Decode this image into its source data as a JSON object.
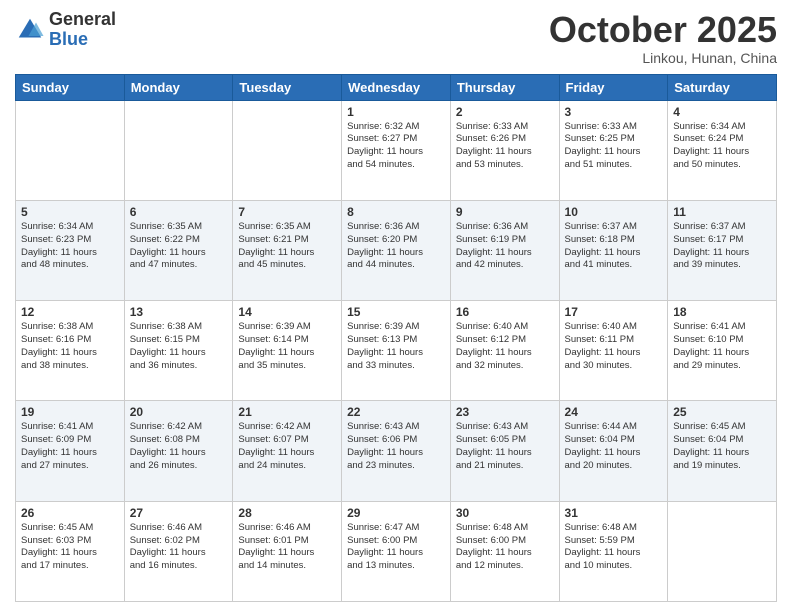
{
  "header": {
    "logo_general": "General",
    "logo_blue": "Blue",
    "month_title": "October 2025",
    "location": "Linkou, Hunan, China"
  },
  "weekdays": [
    "Sunday",
    "Monday",
    "Tuesday",
    "Wednesday",
    "Thursday",
    "Friday",
    "Saturday"
  ],
  "weeks": [
    [
      {
        "day": "",
        "info": ""
      },
      {
        "day": "",
        "info": ""
      },
      {
        "day": "",
        "info": ""
      },
      {
        "day": "1",
        "info": "Sunrise: 6:32 AM\nSunset: 6:27 PM\nDaylight: 11 hours\nand 54 minutes."
      },
      {
        "day": "2",
        "info": "Sunrise: 6:33 AM\nSunset: 6:26 PM\nDaylight: 11 hours\nand 53 minutes."
      },
      {
        "day": "3",
        "info": "Sunrise: 6:33 AM\nSunset: 6:25 PM\nDaylight: 11 hours\nand 51 minutes."
      },
      {
        "day": "4",
        "info": "Sunrise: 6:34 AM\nSunset: 6:24 PM\nDaylight: 11 hours\nand 50 minutes."
      }
    ],
    [
      {
        "day": "5",
        "info": "Sunrise: 6:34 AM\nSunset: 6:23 PM\nDaylight: 11 hours\nand 48 minutes."
      },
      {
        "day": "6",
        "info": "Sunrise: 6:35 AM\nSunset: 6:22 PM\nDaylight: 11 hours\nand 47 minutes."
      },
      {
        "day": "7",
        "info": "Sunrise: 6:35 AM\nSunset: 6:21 PM\nDaylight: 11 hours\nand 45 minutes."
      },
      {
        "day": "8",
        "info": "Sunrise: 6:36 AM\nSunset: 6:20 PM\nDaylight: 11 hours\nand 44 minutes."
      },
      {
        "day": "9",
        "info": "Sunrise: 6:36 AM\nSunset: 6:19 PM\nDaylight: 11 hours\nand 42 minutes."
      },
      {
        "day": "10",
        "info": "Sunrise: 6:37 AM\nSunset: 6:18 PM\nDaylight: 11 hours\nand 41 minutes."
      },
      {
        "day": "11",
        "info": "Sunrise: 6:37 AM\nSunset: 6:17 PM\nDaylight: 11 hours\nand 39 minutes."
      }
    ],
    [
      {
        "day": "12",
        "info": "Sunrise: 6:38 AM\nSunset: 6:16 PM\nDaylight: 11 hours\nand 38 minutes."
      },
      {
        "day": "13",
        "info": "Sunrise: 6:38 AM\nSunset: 6:15 PM\nDaylight: 11 hours\nand 36 minutes."
      },
      {
        "day": "14",
        "info": "Sunrise: 6:39 AM\nSunset: 6:14 PM\nDaylight: 11 hours\nand 35 minutes."
      },
      {
        "day": "15",
        "info": "Sunrise: 6:39 AM\nSunset: 6:13 PM\nDaylight: 11 hours\nand 33 minutes."
      },
      {
        "day": "16",
        "info": "Sunrise: 6:40 AM\nSunset: 6:12 PM\nDaylight: 11 hours\nand 32 minutes."
      },
      {
        "day": "17",
        "info": "Sunrise: 6:40 AM\nSunset: 6:11 PM\nDaylight: 11 hours\nand 30 minutes."
      },
      {
        "day": "18",
        "info": "Sunrise: 6:41 AM\nSunset: 6:10 PM\nDaylight: 11 hours\nand 29 minutes."
      }
    ],
    [
      {
        "day": "19",
        "info": "Sunrise: 6:41 AM\nSunset: 6:09 PM\nDaylight: 11 hours\nand 27 minutes."
      },
      {
        "day": "20",
        "info": "Sunrise: 6:42 AM\nSunset: 6:08 PM\nDaylight: 11 hours\nand 26 minutes."
      },
      {
        "day": "21",
        "info": "Sunrise: 6:42 AM\nSunset: 6:07 PM\nDaylight: 11 hours\nand 24 minutes."
      },
      {
        "day": "22",
        "info": "Sunrise: 6:43 AM\nSunset: 6:06 PM\nDaylight: 11 hours\nand 23 minutes."
      },
      {
        "day": "23",
        "info": "Sunrise: 6:43 AM\nSunset: 6:05 PM\nDaylight: 11 hours\nand 21 minutes."
      },
      {
        "day": "24",
        "info": "Sunrise: 6:44 AM\nSunset: 6:04 PM\nDaylight: 11 hours\nand 20 minutes."
      },
      {
        "day": "25",
        "info": "Sunrise: 6:45 AM\nSunset: 6:04 PM\nDaylight: 11 hours\nand 19 minutes."
      }
    ],
    [
      {
        "day": "26",
        "info": "Sunrise: 6:45 AM\nSunset: 6:03 PM\nDaylight: 11 hours\nand 17 minutes."
      },
      {
        "day": "27",
        "info": "Sunrise: 6:46 AM\nSunset: 6:02 PM\nDaylight: 11 hours\nand 16 minutes."
      },
      {
        "day": "28",
        "info": "Sunrise: 6:46 AM\nSunset: 6:01 PM\nDaylight: 11 hours\nand 14 minutes."
      },
      {
        "day": "29",
        "info": "Sunrise: 6:47 AM\nSunset: 6:00 PM\nDaylight: 11 hours\nand 13 minutes."
      },
      {
        "day": "30",
        "info": "Sunrise: 6:48 AM\nSunset: 6:00 PM\nDaylight: 11 hours\nand 12 minutes."
      },
      {
        "day": "31",
        "info": "Sunrise: 6:48 AM\nSunset: 5:59 PM\nDaylight: 11 hours\nand 10 minutes."
      },
      {
        "day": "",
        "info": ""
      }
    ]
  ]
}
